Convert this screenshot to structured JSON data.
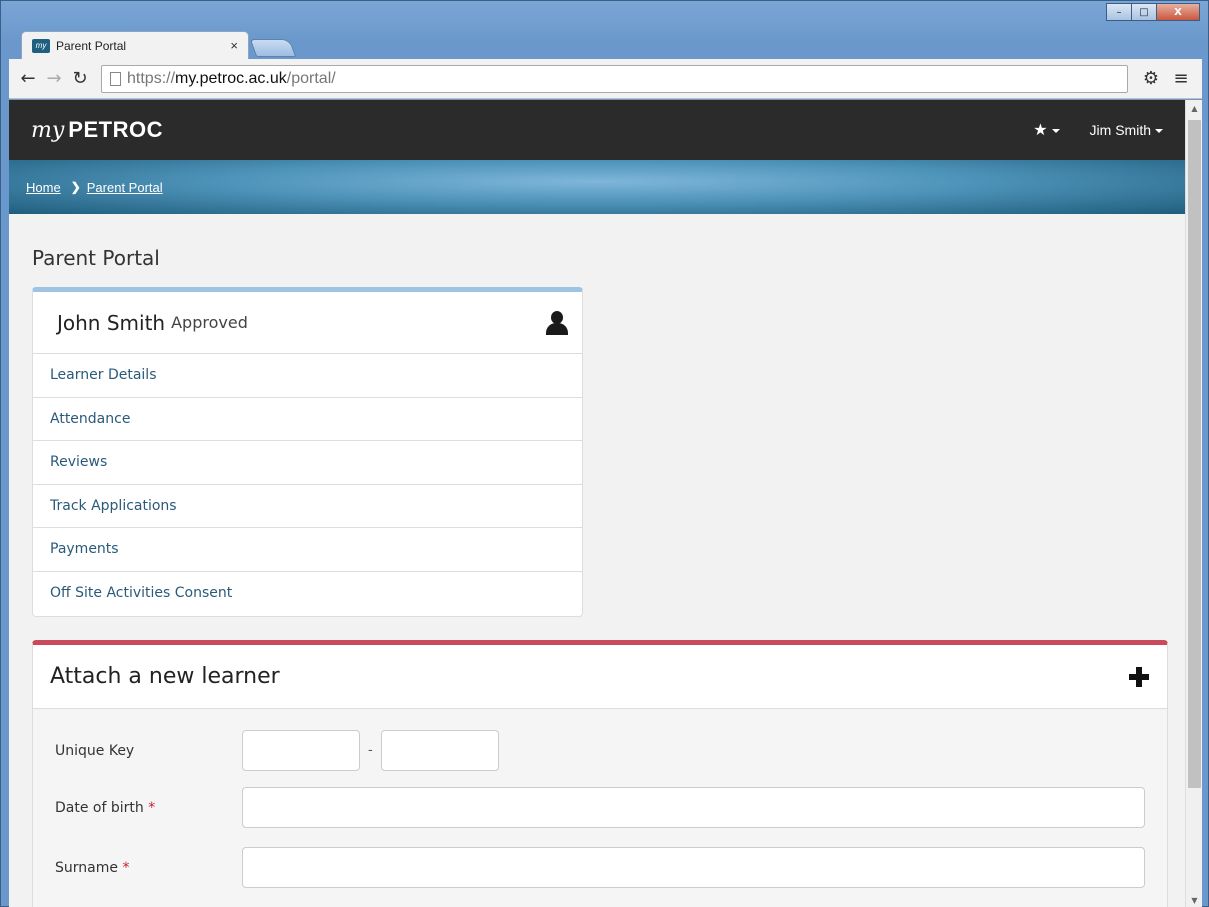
{
  "browser": {
    "tab_title": "Parent Portal",
    "tab_favicon_text": "my",
    "tab_close": "×",
    "url_scheme": "https://",
    "url_host": "my.petroc.ac.uk",
    "url_path": "/portal/",
    "window_controls": {
      "minimize": "–",
      "maximize": "□",
      "close": "X"
    }
  },
  "navbar": {
    "brand_prefix": "my",
    "brand_name": "PETROC",
    "favorites_icon": "★",
    "user_name": "Jim Smith"
  },
  "breadcrumb": {
    "items": [
      "Home",
      "Parent Portal"
    ]
  },
  "page": {
    "title": "Parent Portal"
  },
  "learner": {
    "name": "John Smith",
    "status": "Approved",
    "links": [
      "Learner Details",
      "Attendance",
      "Reviews",
      "Track Applications",
      "Payments",
      "Off Site Activities Consent"
    ]
  },
  "attach_form": {
    "title": "Attach a new learner",
    "unique_key_label": "Unique Key",
    "key_separator": "-",
    "dob_label": "Date of birth",
    "surname_label": "Surname",
    "required_marker": "*"
  },
  "colors": {
    "navbar_bg": "#2b2b2b",
    "learner_accent": "#9ec3e3",
    "attach_accent": "#c94a5a",
    "link_color": "#2a5a7a",
    "required_color": "#c8202e"
  }
}
